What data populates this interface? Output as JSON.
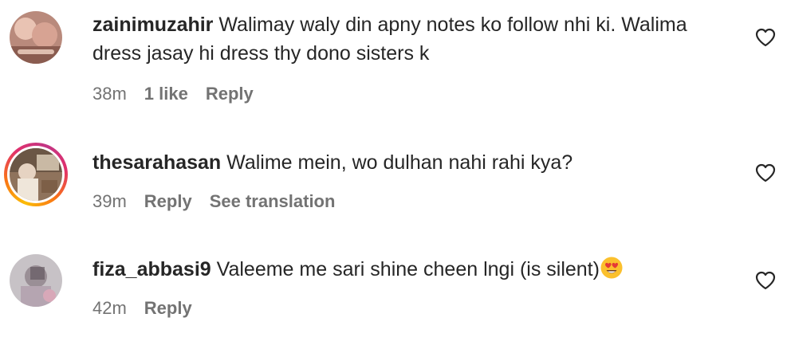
{
  "comments": [
    {
      "username": "zainimuzahir",
      "text": "Walimay waly din apny notes ko follow nhi ki. Walima dress jasay hi dress thy dono sisters k",
      "time": "38m",
      "likes": "1 like",
      "reply": "Reply",
      "avatar_icon": "photo-avatar",
      "has_story_ring": false
    },
    {
      "username": "thesarahasan",
      "text": "Walime mein, wo dulhan nahi rahi kya?",
      "time": "39m",
      "reply": "Reply",
      "translate": "See translation",
      "avatar_icon": "photo-avatar",
      "has_story_ring": true
    },
    {
      "username": "fiza_abbasi9",
      "text": "Valeeme me sari shine cheen lngi (is silent)",
      "emoji": "heart-eyes-emoji",
      "time": "42m",
      "reply": "Reply",
      "avatar_icon": "photo-avatar",
      "has_story_ring": false
    }
  ],
  "icons": {
    "like": "heart-outline-icon"
  },
  "colors": {
    "text": "#262626",
    "secondary": "#737373",
    "story_ring_start": "#fbbd08",
    "story_ring_end": "#c13584"
  }
}
